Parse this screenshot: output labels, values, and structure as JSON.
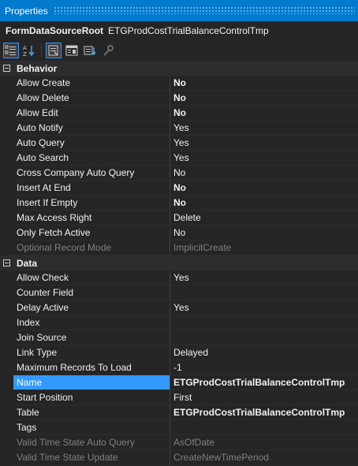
{
  "window": {
    "title": "Properties"
  },
  "object": {
    "name": "FormDataSourceRoot",
    "type": "ETGProdCostTrialBalanceControlTmp"
  },
  "toolbar": {
    "buttons": [
      {
        "name": "categorized-icon",
        "active": true
      },
      {
        "name": "alphabetical-icon",
        "active": false
      },
      {
        "name": "properties-icon",
        "active": true
      },
      {
        "name": "events-icon",
        "active": false
      },
      {
        "name": "property-pages-icon",
        "active": false
      },
      {
        "name": "wrench-icon",
        "active": false
      }
    ]
  },
  "categories": [
    {
      "label": "Behavior",
      "rows": [
        {
          "name": "Allow Create",
          "value": "No",
          "bold": true
        },
        {
          "name": "Allow Delete",
          "value": "No",
          "bold": true
        },
        {
          "name": "Allow Edit",
          "value": "No",
          "bold": true
        },
        {
          "name": "Auto Notify",
          "value": "Yes"
        },
        {
          "name": "Auto Query",
          "value": "Yes"
        },
        {
          "name": "Auto Search",
          "value": "Yes"
        },
        {
          "name": "Cross Company Auto Query",
          "value": "No"
        },
        {
          "name": "Insert At End",
          "value": "No",
          "bold": true
        },
        {
          "name": "Insert If Empty",
          "value": "No",
          "bold": true
        },
        {
          "name": "Max Access Right",
          "value": "Delete"
        },
        {
          "name": "Only Fetch Active",
          "value": "No"
        },
        {
          "name": "Optional Record Mode",
          "value": "ImplicitCreate",
          "disabled": true
        }
      ]
    },
    {
      "label": "Data",
      "rows": [
        {
          "name": "Allow Check",
          "value": "Yes"
        },
        {
          "name": "Counter Field",
          "value": ""
        },
        {
          "name": "Delay Active",
          "value": "Yes"
        },
        {
          "name": "Index",
          "value": ""
        },
        {
          "name": "Join Source",
          "value": ""
        },
        {
          "name": "Link Type",
          "value": "Delayed"
        },
        {
          "name": "Maximum Records To Load",
          "value": "-1"
        },
        {
          "name": "Name",
          "value": "ETGProdCostTrialBalanceControlTmp",
          "bold": true,
          "selected": true
        },
        {
          "name": "Start Position",
          "value": "First"
        },
        {
          "name": "Table",
          "value": "ETGProdCostTrialBalanceControlTmp",
          "bold": true
        },
        {
          "name": "Tags",
          "value": ""
        },
        {
          "name": "Valid Time State Auto Query",
          "value": "AsOfDate",
          "disabled": true
        },
        {
          "name": "Valid Time State Update",
          "value": "CreateNewTimePeriod",
          "disabled": true
        }
      ]
    }
  ]
}
